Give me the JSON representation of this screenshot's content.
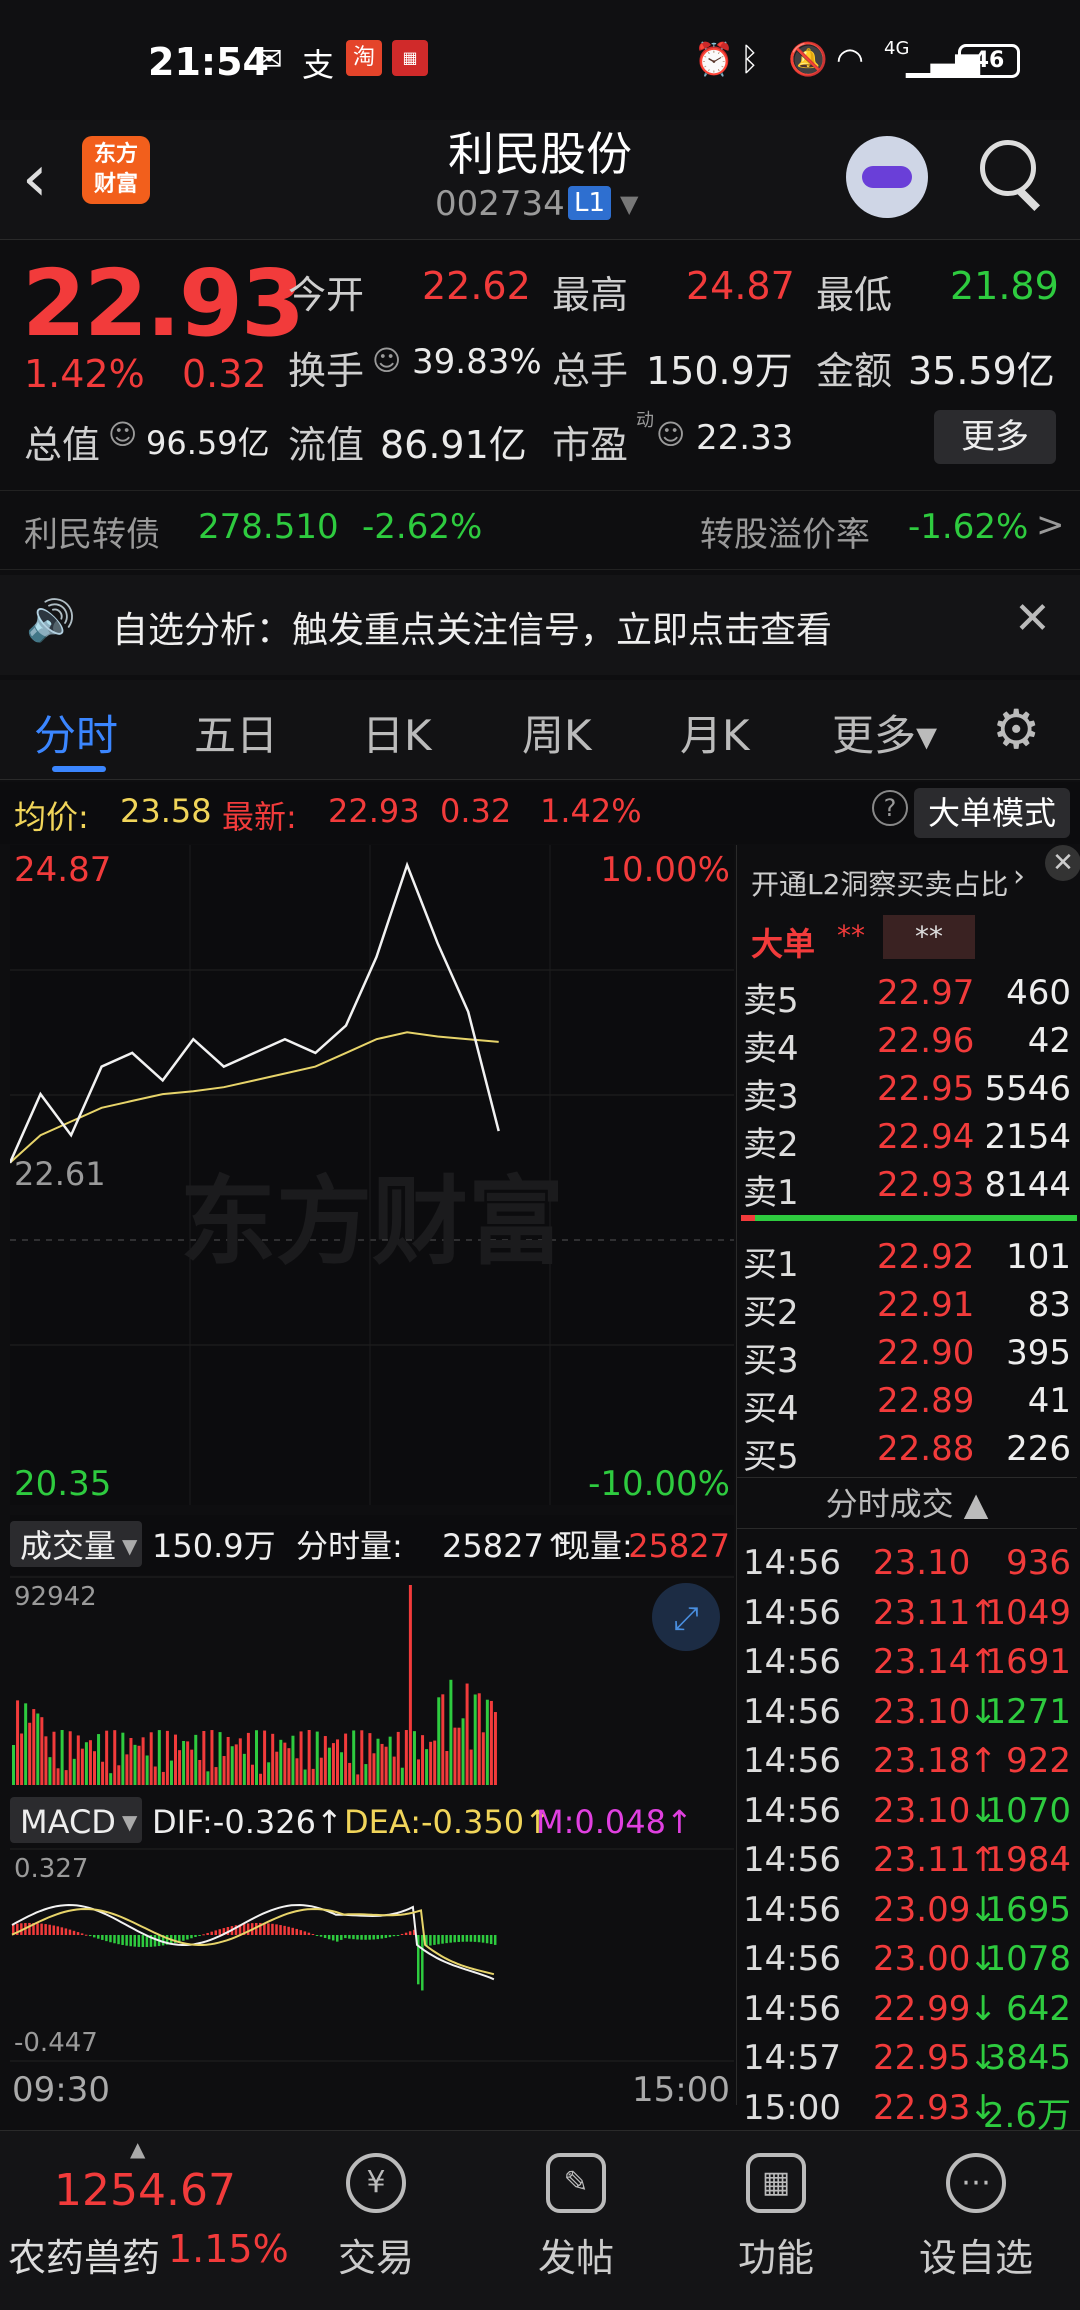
{
  "status_bar": {
    "time": "21:54",
    "battery": "46",
    "network": "4G"
  },
  "header": {
    "logo_line1": "东方",
    "logo_line2": "财富",
    "name": "利民股份",
    "code": "002734",
    "level_badge": "L1"
  },
  "quote": {
    "price": "22.93",
    "pct": "1.42%",
    "change": "0.32",
    "open_label": "今开",
    "open": "22.62",
    "high_label": "最高",
    "high": "24.87",
    "low_label": "最低",
    "low": "21.89",
    "turnover_label": "换手",
    "turnover": "39.83%",
    "volume_label": "总手",
    "volume": "150.9万",
    "amount_label": "金额",
    "amount": "35.59亿",
    "mktcap_label": "总值",
    "mktcap": "96.59亿",
    "float_label": "流值",
    "float": "86.91亿",
    "pe_label": "市盈",
    "pe_sup": "动",
    "pe": "22.33",
    "more": "更多"
  },
  "bond": {
    "name": "利民转债",
    "price": "278.510",
    "pct": "-2.62%",
    "premium_label": "转股溢价率",
    "premium": "-1.62%",
    "arrow": ">"
  },
  "alert": {
    "text": "自选分析：触发重点关注信号，立即点击查看",
    "close": "✕"
  },
  "tabs": [
    "分时",
    "五日",
    "日K",
    "周K",
    "月K",
    "更多▾"
  ],
  "info_line": {
    "avg_label": "均价:",
    "avg": "23.58",
    "latest_label": "最新:",
    "latest": "22.93",
    "change": "0.32",
    "pct": "1.42%",
    "help": "?",
    "big_mode": "大单模式"
  },
  "chart": {
    "price_max": "24.87",
    "price_min": "20.35",
    "pct_max": "10.00%",
    "pct_min": "-10.00%",
    "pre_close": "22.61",
    "volume_label": "成交量",
    "volume_total": "150.9万",
    "tick_vol_label": "分时量:",
    "tick_vol": "25827↑",
    "cur_vol_label": "现量:",
    "cur_vol": "25827",
    "vol_max": "92942",
    "macd_label": "MACD",
    "dif": "DIF:-0.326↑",
    "dea": "DEA:-0.350↑",
    "m": "M:0.048↑",
    "macd_max": "0.327",
    "macd_min": "-0.447",
    "time_start": "09:30",
    "time_end": "15:00",
    "watermark": "东方财富"
  },
  "chart_data": {
    "type": "line",
    "x_range": [
      "09:30",
      "15:00"
    ],
    "ylim": [
      20.35,
      24.87
    ],
    "series": [
      {
        "name": "最新",
        "values": [
          22.7,
          23.2,
          22.9,
          23.4,
          23.5,
          23.3,
          23.6,
          23.4,
          23.5,
          23.6,
          23.5,
          23.7,
          24.2,
          24.87,
          24.3,
          23.8,
          22.93
        ]
      },
      {
        "name": "均价",
        "values": [
          22.7,
          22.9,
          23.0,
          23.1,
          23.15,
          23.2,
          23.22,
          23.25,
          23.3,
          23.35,
          23.4,
          23.5,
          23.6,
          23.65,
          23.62,
          23.6,
          23.58
        ]
      }
    ]
  },
  "order_book": {
    "title": "开通L2洞察买卖占比",
    "big_label": "大单",
    "big_a": "**",
    "big_b": "**",
    "asks": [
      {
        "label": "卖5",
        "price": "22.97",
        "qty": "460"
      },
      {
        "label": "卖4",
        "price": "22.96",
        "qty": "42"
      },
      {
        "label": "卖3",
        "price": "22.95",
        "qty": "5546"
      },
      {
        "label": "卖2",
        "price": "22.94",
        "qty": "2154"
      },
      {
        "label": "卖1",
        "price": "22.93",
        "qty": "8144"
      }
    ],
    "bids": [
      {
        "label": "买1",
        "price": "22.92",
        "qty": "101"
      },
      {
        "label": "买2",
        "price": "22.91",
        "qty": "83"
      },
      {
        "label": "买3",
        "price": "22.90",
        "qty": "395"
      },
      {
        "label": "买4",
        "price": "22.89",
        "qty": "41"
      },
      {
        "label": "买5",
        "price": "22.88",
        "qty": "226"
      }
    ],
    "ticks_title": "分时成交"
  },
  "ticks": [
    {
      "time": "14:56",
      "price": "23.10",
      "vol": "936",
      "dir": ""
    },
    {
      "time": "14:56",
      "price": "23.11",
      "vol": "1049",
      "dir": "↑"
    },
    {
      "time": "14:56",
      "price": "23.14",
      "vol": "1691",
      "dir": "↑"
    },
    {
      "time": "14:56",
      "price": "23.10",
      "vol": "1271",
      "dir": "↓"
    },
    {
      "time": "14:56",
      "price": "23.18",
      "vol": "922",
      "dir": "↑"
    },
    {
      "time": "14:56",
      "price": "23.10",
      "vol": "1070",
      "dir": "↓"
    },
    {
      "time": "14:56",
      "price": "23.11",
      "vol": "1984",
      "dir": "↑"
    },
    {
      "time": "14:56",
      "price": "23.09",
      "vol": "1695",
      "dir": "↓"
    },
    {
      "time": "14:56",
      "price": "23.00",
      "vol": "1078",
      "dir": "↓"
    },
    {
      "time": "14:56",
      "price": "22.99",
      "vol": "642",
      "dir": "↓"
    },
    {
      "time": "14:57",
      "price": "22.95",
      "vol": "3845",
      "dir": "↓"
    },
    {
      "time": "15:00",
      "price": "22.93",
      "vol": "2.6万",
      "dir": "↓"
    }
  ],
  "bottom_nav": {
    "index_value": "1254.67",
    "index_name": "农药兽药",
    "index_pct": "1.15%",
    "items": [
      {
        "label": "交易",
        "icon": "¥"
      },
      {
        "label": "发帖",
        "icon": "✎"
      },
      {
        "label": "功能",
        "icon": "▦"
      },
      {
        "label": "设自选",
        "icon": "⋯"
      }
    ]
  }
}
